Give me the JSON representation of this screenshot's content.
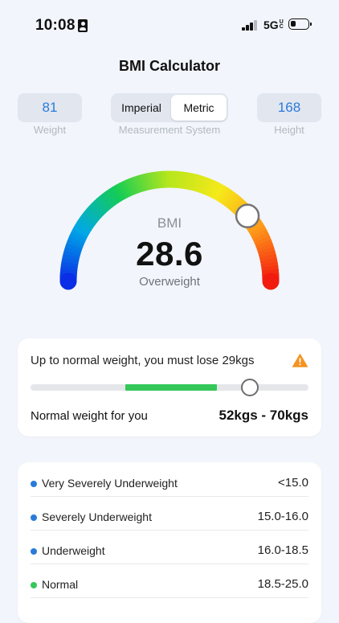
{
  "status_bar": {
    "time": "10:08",
    "network": "5G",
    "network_badge": "UC"
  },
  "title": "BMI Calculator",
  "weight": {
    "value": "81",
    "label": "Weight"
  },
  "height": {
    "value": "168",
    "label": "Height"
  },
  "measurement": {
    "options": [
      "Imperial",
      "Metric"
    ],
    "selected": "Metric",
    "label": "Measurement System"
  },
  "gauge": {
    "label": "BMI",
    "value": "28.6",
    "category": "Overweight",
    "level": 0.78,
    "colors": [
      "#0a2de6",
      "#00a8e6",
      "#14cc55",
      "#b6e61c",
      "#f6e91a",
      "#ff9a1a",
      "#f21b0f"
    ]
  },
  "advice": {
    "message": "Up to normal weight, you must lose 29kgs",
    "icon": "warning-icon",
    "normal_label": "Normal weight for you",
    "normal_range": "52kgs - 70kgs",
    "range_fill_start": 0.34,
    "range_fill_end": 0.67,
    "knob_position": 0.79
  },
  "colors": {
    "accent": "#2a7bd8",
    "green": "#34c759",
    "warning": "#f59322"
  },
  "categories": [
    {
      "label": "Very Severely Underweight",
      "range": "<15.0",
      "color": "#2a7bd8"
    },
    {
      "label": "Severely Underweight",
      "range": "15.0-16.0",
      "color": "#2a7bd8"
    },
    {
      "label": "Underweight",
      "range": "16.0-18.5",
      "color": "#2a7bd8"
    },
    {
      "label": "Normal",
      "range": "18.5-25.0",
      "color": "#34c759"
    }
  ]
}
